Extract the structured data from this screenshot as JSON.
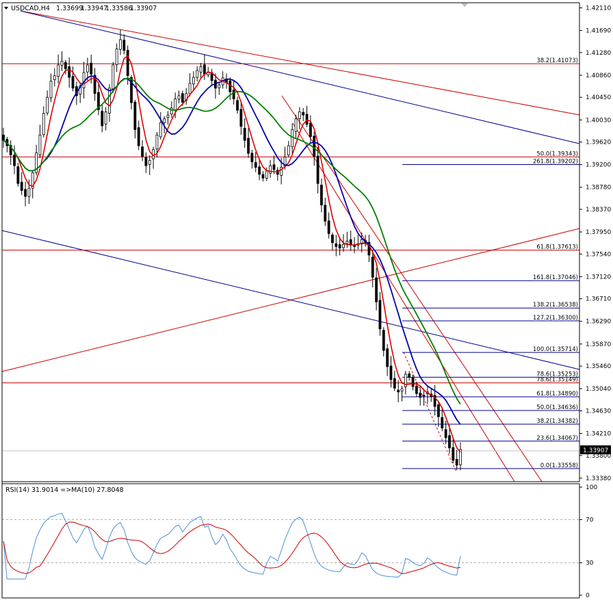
{
  "chart_header": {
    "symbol_text": "USDCAD,H4",
    "open": "1.33699",
    "high": "1.33947",
    "low": "1.33586",
    "close": "1.33907"
  },
  "price_axis": {
    "ticks": [
      "1.42110",
      "1.41690",
      "1.41280",
      "1.40860",
      "1.40450",
      "1.40030",
      "1.39620",
      "1.39200",
      "1.38780",
      "1.38370",
      "1.37950",
      "1.37540",
      "1.37120",
      "1.36710",
      "1.36290",
      "1.35870",
      "1.35460",
      "1.35040",
      "1.34630",
      "1.34210",
      "1.33800",
      "1.33380"
    ],
    "current_price": "1.33907",
    "range": [
      1.3334,
      1.4218
    ]
  },
  "rsi_panel": {
    "label": "RSI(14) 31.9014  =>MA(10) 27.8048",
    "ticks": [
      "100",
      "70",
      "30",
      "0"
    ],
    "levels": [
      70,
      30
    ]
  },
  "fib_levels": [
    {
      "label": "38.2(1.41073)",
      "price": 1.41073,
      "color": "#cc0000"
    },
    {
      "label": "50.0(1.39343)",
      "price": 1.39343,
      "color": "#cc0000"
    },
    {
      "label": "261.8(1.39202)",
      "price": 1.39202,
      "color": "#00008b"
    },
    {
      "label": "61.8(1.37613)",
      "price": 1.37613,
      "color": "#cc0000"
    },
    {
      "label": "161.8(1.37046)",
      "price": 1.37046,
      "color": "#00008b"
    },
    {
      "label": "138.2(1.36538)",
      "price": 1.36538,
      "color": "#00008b"
    },
    {
      "label": "127.2(1.36300)",
      "price": 1.363,
      "color": "#00008b"
    },
    {
      "label": "100.0(1.35714)",
      "price": 1.35714,
      "color": "#00008b"
    },
    {
      "label": "78.6(1.35253)",
      "price": 1.35253,
      "color": "#00008b"
    },
    {
      "label": "78.6(1.35149)",
      "price": 1.35149,
      "color": "#cc0000"
    },
    {
      "label": "61.8(1.34890)",
      "price": 1.3489,
      "color": "#00008b"
    },
    {
      "label": "50.0(1.34636)",
      "price": 1.34636,
      "color": "#00008b"
    },
    {
      "label": "38.2(1.34382)",
      "price": 1.34382,
      "color": "#00008b"
    },
    {
      "label": "23.6(1.34067)",
      "price": 1.34067,
      "color": "#00008b"
    },
    {
      "label": "0.0(1.33558)",
      "price": 1.33558,
      "color": "#00008b"
    }
  ],
  "chart_data": {
    "type": "candlestick",
    "title": "USDCAD,H4",
    "ylim": [
      1.3334,
      1.4218
    ],
    "grid": false,
    "closes": [
      1.3965,
      1.3955,
      1.3938,
      1.3918,
      1.3885,
      1.3872,
      1.3861,
      1.3876,
      1.3905,
      1.3942,
      1.3975,
      1.4015,
      1.4045,
      1.4075,
      1.4085,
      1.4105,
      1.4112,
      1.4098,
      1.4082,
      1.4062,
      1.4048,
      1.4066,
      1.4091,
      1.4105,
      1.4088,
      1.4052,
      1.4022,
      1.3992,
      1.4018,
      1.4062,
      1.4105,
      1.4135,
      1.4152,
      1.4132,
      1.4085,
      1.4035,
      1.3985,
      1.3955,
      1.3935,
      1.3918,
      1.3928,
      1.3948,
      1.3975,
      1.3998,
      1.4005,
      1.4012,
      1.4025,
      1.4042,
      1.4048,
      1.4036,
      1.4052,
      1.4071,
      1.4082,
      1.4095,
      1.4102,
      1.4088,
      1.4092,
      1.4076,
      1.4062,
      1.4068,
      1.4081,
      1.4072,
      1.4055,
      1.4042,
      1.4021,
      1.3991,
      1.3965,
      1.3941,
      1.3925,
      1.3915,
      1.3902,
      1.3895,
      1.3908,
      1.3918,
      1.3911,
      1.3902,
      1.3915,
      1.3934,
      1.3955,
      1.3985,
      1.4005,
      1.4018,
      1.4012,
      1.3995,
      1.3972,
      1.3935,
      1.3885,
      1.3845,
      1.3815,
      1.3792,
      1.3775,
      1.3768,
      1.3765,
      1.3772,
      1.3778,
      1.3771,
      1.3768,
      1.3773,
      1.3781,
      1.3775,
      1.3752,
      1.3711,
      1.3665,
      1.3615,
      1.3575,
      1.3545,
      1.3521,
      1.3505,
      1.3498,
      1.3504,
      1.3531,
      1.3525,
      1.3508,
      1.3495,
      1.3488,
      1.3491,
      1.3498,
      1.3489,
      1.3471,
      1.3452,
      1.3431,
      1.3413,
      1.3394,
      1.3371,
      1.3362,
      1.3391
    ]
  }
}
